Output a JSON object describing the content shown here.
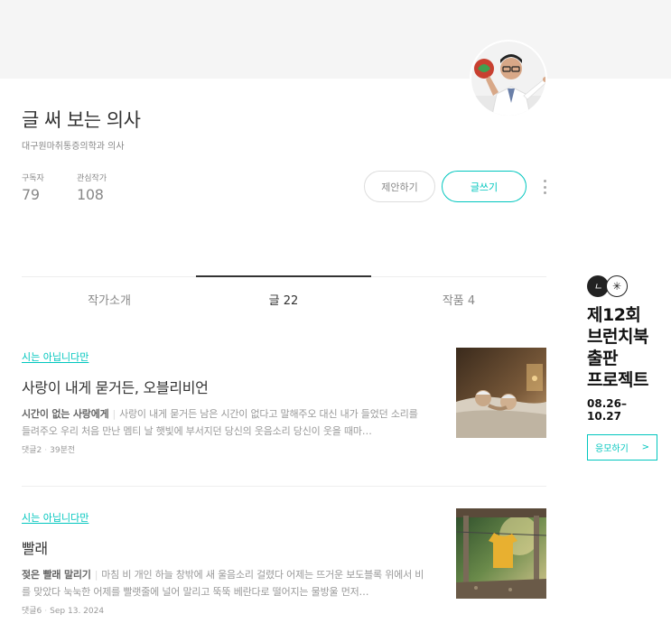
{
  "profile": {
    "name": "글 써 보는 의사",
    "description": "대구원마취통증의학과 의사",
    "stats": [
      {
        "label": "구독자",
        "value": "79"
      },
      {
        "label": "관심작가",
        "value": "108"
      }
    ],
    "propose_label": "제안하기",
    "write_label": "글쓰기"
  },
  "tabs": [
    {
      "label": "작가소개",
      "active": false
    },
    {
      "label": "글 22",
      "active": true
    },
    {
      "label": "작품 4",
      "active": false
    }
  ],
  "posts": [
    {
      "category": "시는 아닙니다만",
      "title": "사랑이 내게 묻거든, 오블리비언",
      "subtitle": "시간이 없는 사랑에게",
      "excerpt": "사랑이 내게 묻거든 남은 시간이 없다고 말해주오 대신 내가 들었던 소리를 들려주오 우리 처음 만난 멤티 날 햇빛에 부서지던 당신의 웃음소리 당신이 웃을 때마…",
      "comments": "댓글2",
      "time": "39분전"
    },
    {
      "category": "시는 아닙니다만",
      "title": "빨래",
      "subtitle": "젖은 빨래 말리기",
      "excerpt": "마침 비 개인 하늘 창밖에 새 울음소리 걸렸다 어제는 뜨거운 보도블록 위에서 비를 맞았다 눅눅한 어제를 빨랫줄에 널어 말리고 뚝뚝 베란다로 떨어지는 물방울 먼저…",
      "comments": "댓글6",
      "time": "Sep 13. 2024"
    }
  ],
  "ad": {
    "logo_left": "ㄴ",
    "logo_right": "✳",
    "title_lines": [
      "제12회",
      "브런치북",
      "출판",
      "프로젝트"
    ],
    "date": "08.26– 10.27",
    "button_label": "응모하기",
    "button_arrow": ">"
  },
  "colors": {
    "accent": "#00c6be",
    "header_band": "#f5f5f5"
  },
  "icons": {
    "more": "more-vertical-icon"
  }
}
